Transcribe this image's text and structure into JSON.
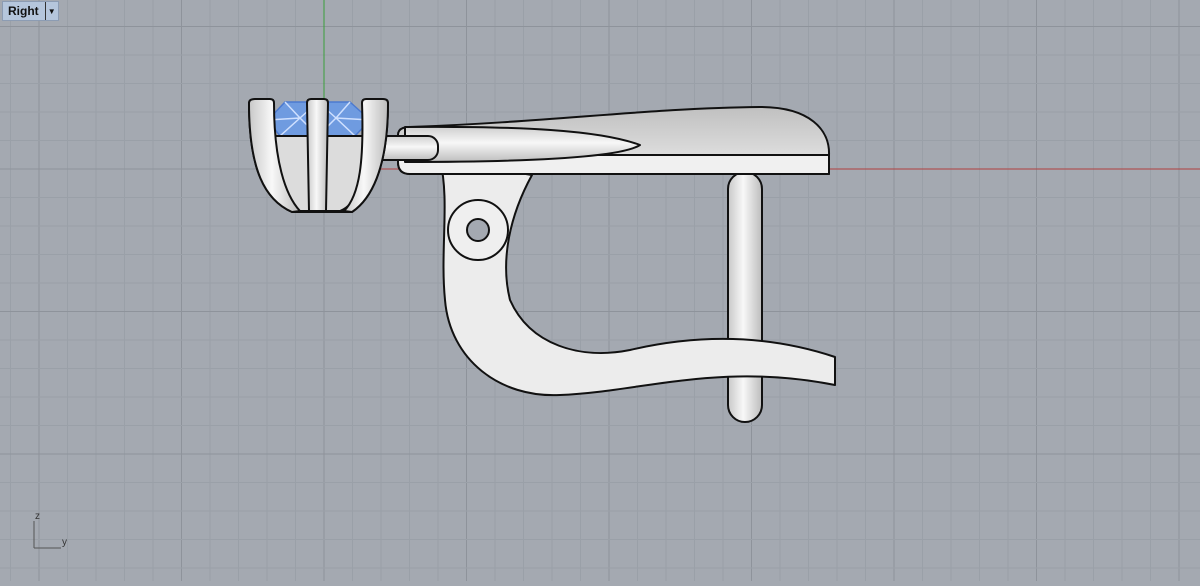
{
  "viewport": {
    "name": "Right",
    "dropdown_icon": "triangle-down-icon",
    "axis_labels": {
      "vertical": "z",
      "horizontal": "y"
    }
  },
  "colors": {
    "background": "#a4a9b1",
    "grid_minor": "#9aa0a8",
    "grid_major": "#8e939b",
    "x_axis": "#b04040",
    "z_axis": "#3aa03a",
    "gem": "#6f9be0",
    "model": "#e6e6e6"
  }
}
